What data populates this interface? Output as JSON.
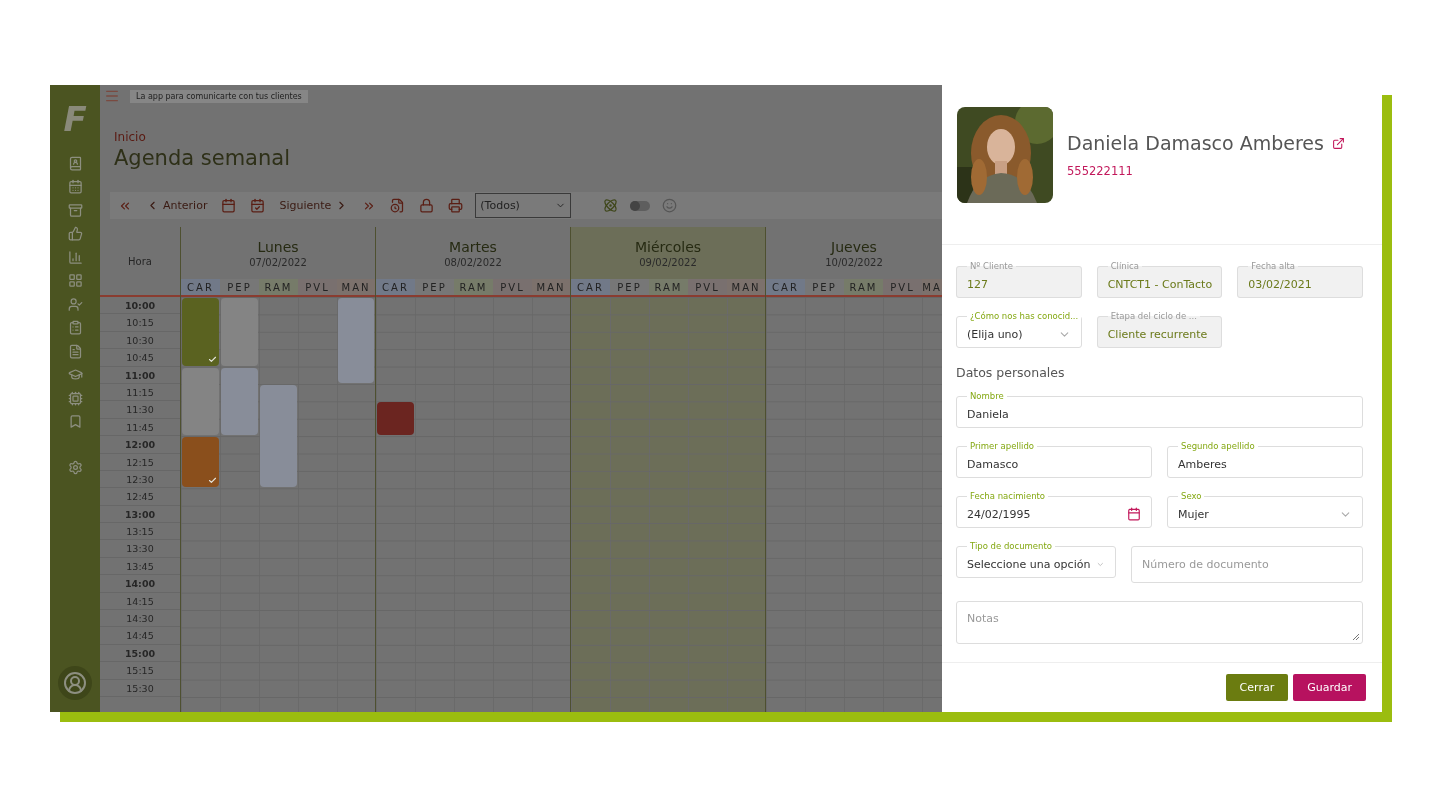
{
  "sidebar": {
    "logo": "F"
  },
  "topbar": {
    "banner": "La app para comunicarte con tus clientes"
  },
  "breadcrumb": "Inicio",
  "title": "Agenda semanal",
  "toolbar": {
    "previous": "Anterior",
    "next": "Siguiente",
    "filter": "(Todos)",
    "toggle_on": false
  },
  "calendar": {
    "hour_header": "Hora",
    "times": [
      "10:00",
      "10:15",
      "10:30",
      "10:45",
      "11:00",
      "11:15",
      "11:30",
      "11:45",
      "12:00",
      "12:15",
      "12:30",
      "12:45",
      "13:00",
      "13:15",
      "13:30",
      "13:45",
      "14:00",
      "14:15",
      "14:30",
      "14:45",
      "15:00",
      "15:15",
      "15:30"
    ],
    "days": [
      {
        "name": "Lunes",
        "date": "07/02/2022",
        "highlighted": false,
        "columns": [
          {
            "label": "CAR",
            "color": "#717988"
          },
          {
            "label": "PEP",
            "color": "#777777"
          },
          {
            "label": "RAM",
            "color": "#767b69"
          },
          {
            "label": "PVL",
            "color": "#79706f"
          },
          {
            "label": "MAN",
            "color": "#7c716c"
          }
        ]
      },
      {
        "name": "Martes",
        "date": "08/02/2022",
        "highlighted": false,
        "columns": [
          {
            "label": "CAR",
            "color": "#717988"
          },
          {
            "label": "PEP",
            "color": "#777777"
          },
          {
            "label": "RAM",
            "color": "#767b69"
          },
          {
            "label": "PVL",
            "color": "#79706f"
          },
          {
            "label": "MAN",
            "color": "#7c716c"
          }
        ]
      },
      {
        "name": "Miércoles",
        "date": "09/02/2022",
        "highlighted": true,
        "columns": [
          {
            "label": "CAR",
            "color": "#717988"
          },
          {
            "label": "PEP",
            "color": "#777777"
          },
          {
            "label": "RAM",
            "color": "#767b69"
          },
          {
            "label": "PVL",
            "color": "#79706f"
          },
          {
            "label": "MAN",
            "color": "#7c716c"
          }
        ]
      },
      {
        "name": "Jueves",
        "date": "10/02/2022",
        "highlighted": false,
        "columns": [
          {
            "label": "CAR",
            "color": "#717988"
          },
          {
            "label": "PEP",
            "color": "#777777"
          },
          {
            "label": "RAM",
            "color": "#767b69"
          },
          {
            "label": "PVL",
            "color": "#79706f"
          },
          {
            "label": "MA",
            "color": "#7c716c"
          }
        ]
      }
    ],
    "events": [
      {
        "color": "#5a6220",
        "confirmed": true
      },
      {
        "color": "#848484",
        "confirmed": false
      },
      {
        "color": "#888d99",
        "confirmed": false
      },
      {
        "color": "#848484",
        "confirmed": false
      },
      {
        "color": "#888d99",
        "confirmed": false
      },
      {
        "color": "#888d99",
        "confirmed": false
      },
      {
        "color": "#8a4f1c",
        "confirmed": true
      },
      {
        "color": "#6b2520",
        "confirmed": false
      }
    ]
  },
  "client": {
    "name": "Daniela Damasco Amberes",
    "phone": "555222111",
    "rows": [
      [
        {
          "kind": "readonly",
          "label": "Nº Cliente",
          "value": "127"
        },
        {
          "kind": "readonly",
          "label": "Clínica",
          "value": "CNTCT1 - ConTacto"
        },
        {
          "kind": "readonly",
          "label": "Fecha alta",
          "value": "03/02/2021"
        }
      ],
      [
        {
          "kind": "select",
          "label": "¿Cómo nos has conocid...",
          "value": "(Elija uno)"
        },
        {
          "kind": "readonly",
          "label": "Etapa del ciclo de ...",
          "value": "Cliente recurrente"
        }
      ]
    ],
    "personal": {
      "title": "Datos personales",
      "rows": [
        [
          {
            "kind": "text",
            "label": "Nombre",
            "value": "Daniela"
          }
        ],
        [
          {
            "kind": "text",
            "label": "Primer apellido",
            "value": "Damasco"
          },
          {
            "kind": "text",
            "label": "Segundo apellido",
            "value": "Amberes"
          }
        ],
        [
          {
            "kind": "date",
            "label": "Fecha nacimiento",
            "value": "24/02/1995"
          },
          {
            "kind": "select",
            "label": "Sexo",
            "value": "Mujer"
          }
        ],
        [
          {
            "kind": "select",
            "label": "Tipo de documento",
            "value": "Seleccione una opción"
          },
          {
            "kind": "text",
            "placeholder": "Número de documento"
          }
        ],
        [
          {
            "kind": "textarea",
            "placeholder": "Notas"
          }
        ]
      ]
    },
    "buttons": [
      {
        "kind": "secondary",
        "label": "Cerrar"
      },
      {
        "kind": "primary",
        "label": "Guardar"
      }
    ]
  }
}
